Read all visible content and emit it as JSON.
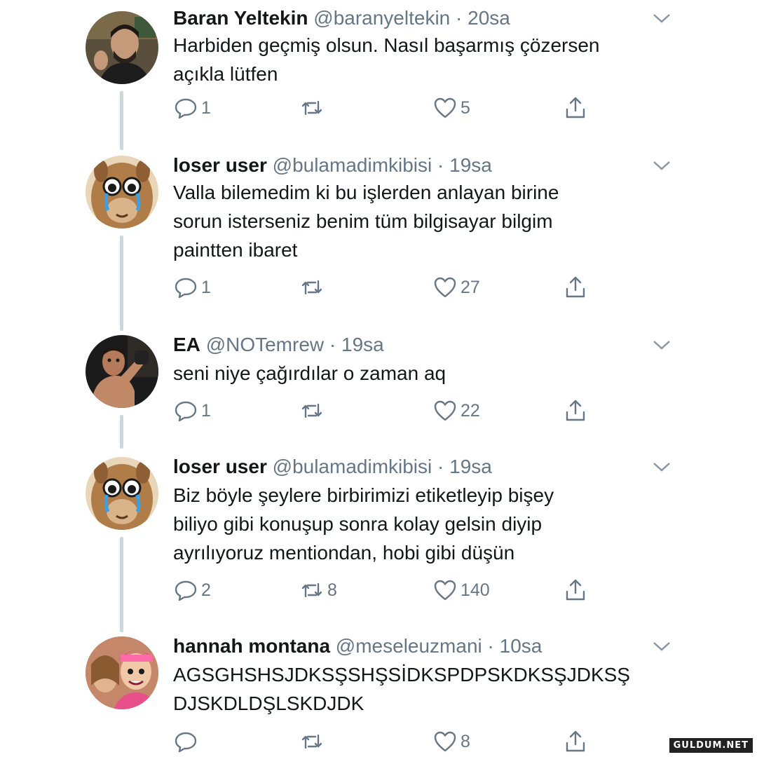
{
  "tweets": [
    {
      "name": "Baran Yeltekin",
      "handle": "@baranyeltekin",
      "sep": " · ",
      "time": "20sa",
      "lines": [
        "Harbiden geçmiş olsun. Nasıl başarmış çözersen",
        "açıkla lütfen"
      ],
      "replies": "1",
      "retweets": "",
      "likes": "5",
      "avatar": "man-photo"
    },
    {
      "name": "loser user",
      "handle": "@bulamadimkibisi",
      "sep": " · ",
      "time": "19sa",
      "lines": [
        "Valla bilemedim ki bu işlerden anlayan birine",
        "sorun isterseniz benim tüm bilgisayar bilgim",
        "paintten ibaret"
      ],
      "replies": "1",
      "retweets": "",
      "likes": "27",
      "avatar": "crying-alpaca"
    },
    {
      "name": "EA",
      "handle": "@NOTemrew",
      "sep": " · ",
      "time": "19sa",
      "lines": [
        "seni niye çağırdılar o zaman aq"
      ],
      "replies": "1",
      "retweets": "",
      "likes": "22",
      "avatar": "fighter-photo"
    },
    {
      "name": "loser user",
      "handle": "@bulamadimkibisi",
      "sep": " · ",
      "time": "19sa",
      "lines": [
        "Biz böyle şeylere birbirimizi etiketleyip bişey",
        "biliyo gibi konuşup sonra kolay gelsin diyip",
        "ayrılıyoruz mentiondan, hobi gibi düşün"
      ],
      "replies": "2",
      "retweets": "8",
      "likes": "140",
      "avatar": "crying-alpaca"
    },
    {
      "name": "hannah montana",
      "handle": "@meseleuzmani",
      "sep": " · ",
      "time": "10sa",
      "lines": [
        "AGSGHSHSJDKSŞSHŞSİDKSPDPSKDKSŞJDKSŞ",
        "DJSKDLDŞLSKDJDK"
      ],
      "replies": "",
      "retweets": "",
      "likes": "8",
      "avatar": "tv-still"
    }
  ],
  "icons": {
    "reply": "reply-icon",
    "retweet": "retweet-icon",
    "like": "heart-icon",
    "share": "share-icon",
    "caret": "chevron-down-icon"
  },
  "colors": {
    "text": "#14171a",
    "secondary": "#657786",
    "thread_line": "#ccd6dd"
  },
  "watermark": "GULDUM.NET"
}
